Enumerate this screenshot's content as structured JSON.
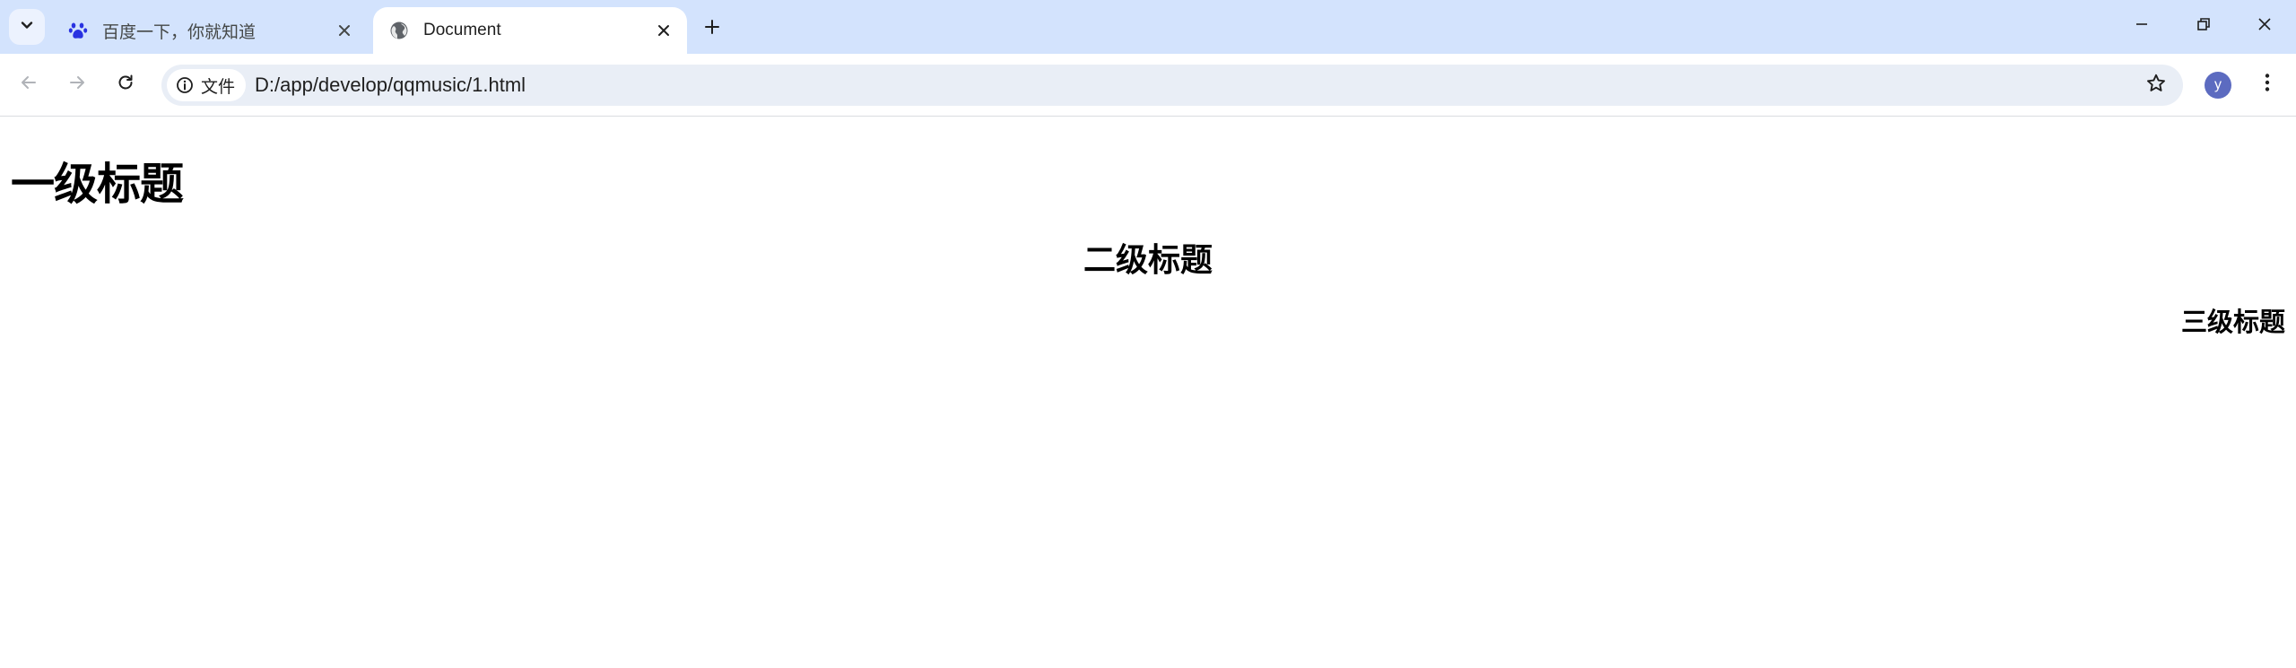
{
  "browser": {
    "tabs": [
      {
        "title": "百度一下，你就知道",
        "favicon": "baidu-paw-icon",
        "active": false
      },
      {
        "title": "Document",
        "favicon": "globe-icon",
        "active": true
      }
    ],
    "address_bar": {
      "security_chip_label": "文件",
      "url": "D:/app/develop/qqmusic/1.html"
    },
    "profile_initial": "y"
  },
  "page": {
    "h1": "一级标题",
    "h2": "二级标题",
    "h3": "三级标题"
  },
  "colors": {
    "tabbar_bg": "#d3e3fd",
    "omnibox_bg": "#e9eef6",
    "avatar_bg": "#5c6bc0"
  }
}
